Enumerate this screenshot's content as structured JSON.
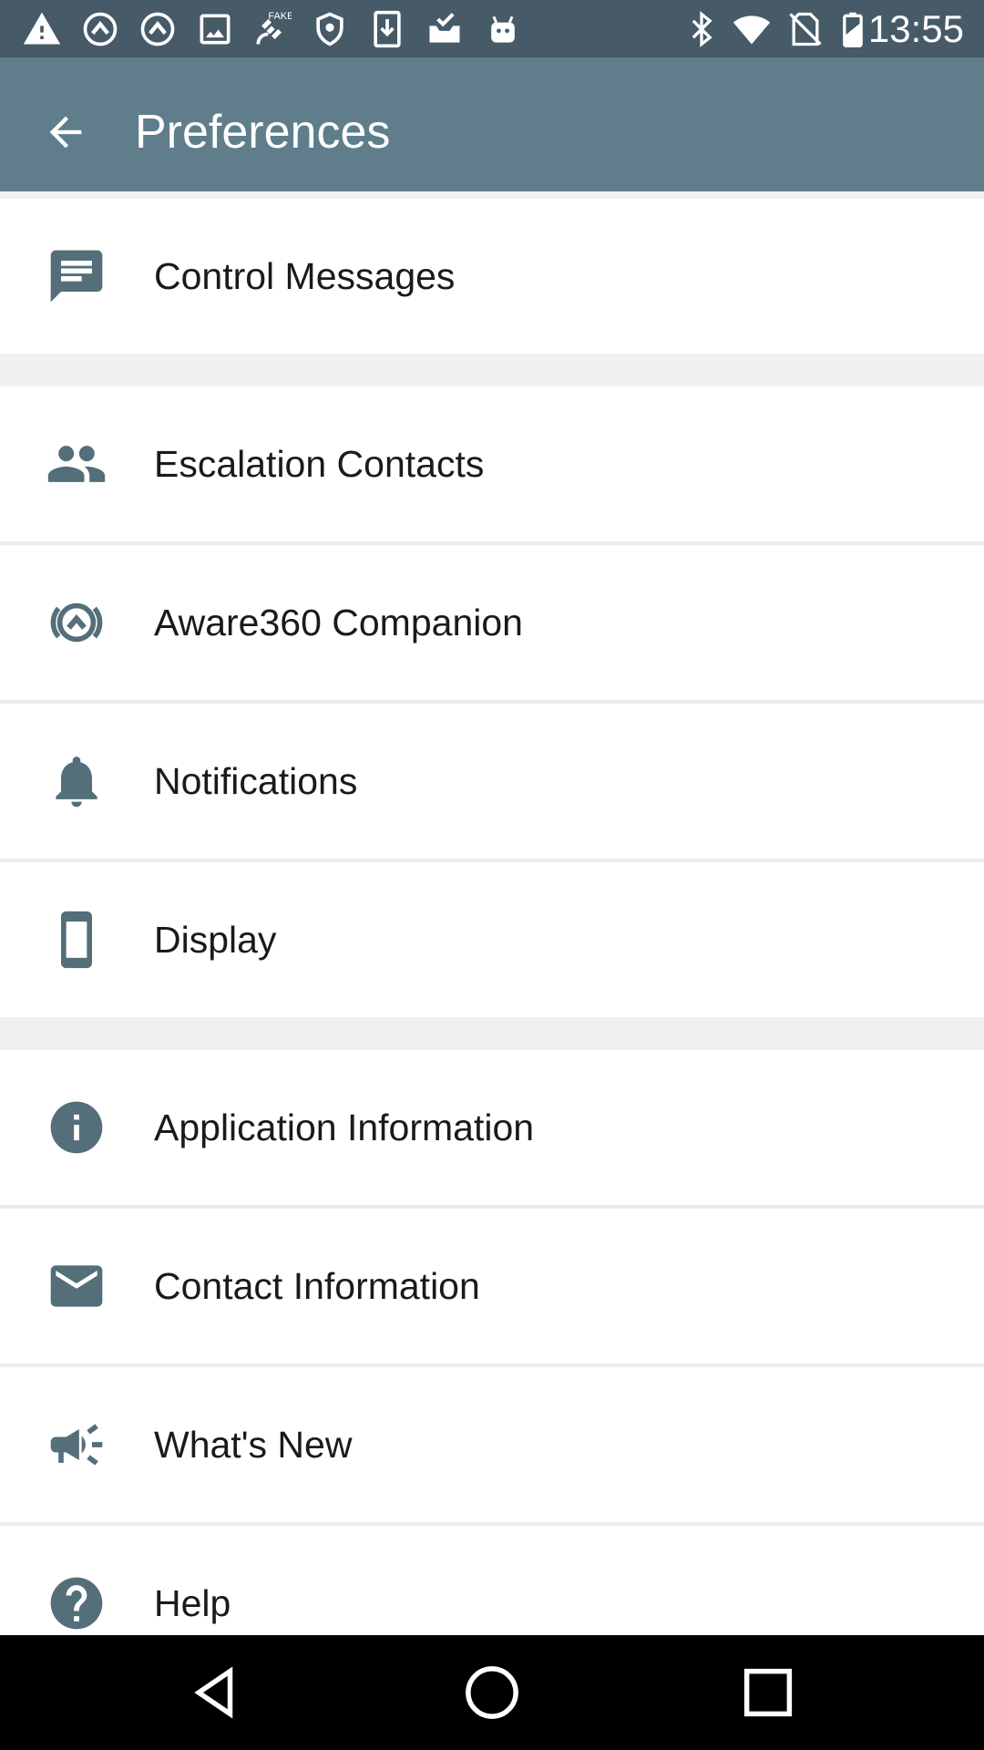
{
  "status_bar": {
    "time": "13:55",
    "left_icons": [
      "warning-icon",
      "aware-icon",
      "aware-icon",
      "image-icon",
      "fake-gps-icon",
      "shield-icon",
      "download-icon",
      "inbox-check-icon",
      "android-icon"
    ],
    "right_icons": [
      "bluetooth-icon",
      "wifi-icon",
      "no-sim-icon",
      "battery-icon"
    ]
  },
  "app_bar": {
    "title": "Preferences",
    "background": "#607d8b"
  },
  "menu": {
    "control_messages": "Control Messages",
    "escalation_contacts": "Escalation Contacts",
    "aware360_companion": "Aware360 Companion",
    "notifications": "Notifications",
    "display": "Display",
    "application_information": "Application Information",
    "contact_information": "Contact Information",
    "whats_new": "What's New",
    "help": "Help"
  },
  "colors": {
    "icon": "#546e7a",
    "status_bar": "#465a67"
  }
}
